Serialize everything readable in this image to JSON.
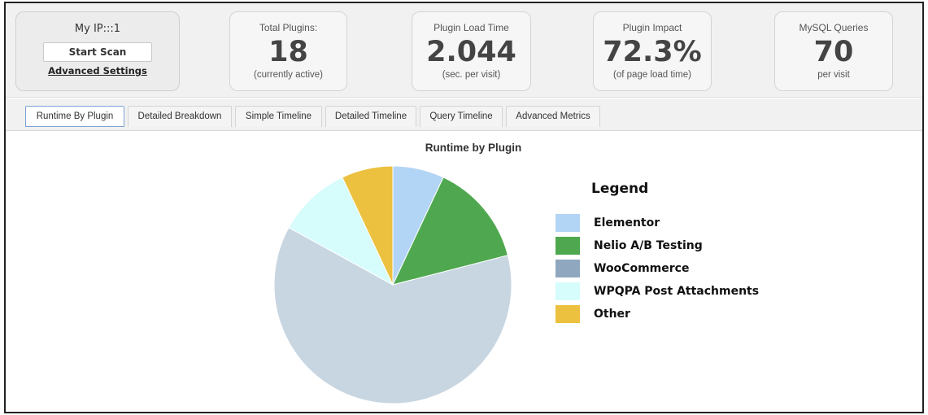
{
  "header": {
    "ip_label": "My IP:::1",
    "start_scan_label": "Start Scan",
    "advanced_settings_label": "Advanced Settings"
  },
  "stats": {
    "total_plugins": {
      "label": "Total Plugins:",
      "value": "18",
      "sub": "(currently active)"
    },
    "plugin_load_time": {
      "label": "Plugin Load Time",
      "value": "2.044",
      "sub": "(sec. per visit)"
    },
    "plugin_impact": {
      "label": "Plugin Impact",
      "value": "72.3%",
      "sub": "(of page load time)"
    },
    "mysql_queries": {
      "label": "MySQL Queries",
      "value": "70",
      "sub": "per visit"
    }
  },
  "tabs": [
    {
      "label": "Runtime By Plugin",
      "active": true
    },
    {
      "label": "Detailed Breakdown",
      "active": false
    },
    {
      "label": "Simple Timeline",
      "active": false
    },
    {
      "label": "Detailed Timeline",
      "active": false
    },
    {
      "label": "Query Timeline",
      "active": false
    },
    {
      "label": "Advanced Metrics",
      "active": false
    }
  ],
  "chart_data": {
    "type": "pie",
    "title": "Runtime by Plugin",
    "legend_title": "Legend",
    "legend_position": "right",
    "series": [
      {
        "name": "Elementor",
        "value": 7,
        "color": "#b3d5f5"
      },
      {
        "name": "Nelio A/B Testing",
        "value": 14,
        "color": "#4fa84f"
      },
      {
        "name": "WooCommerce",
        "value": 62,
        "color": "#c8d6e2",
        "legend_color": "#8fa8bf"
      },
      {
        "name": "WPQPA Post Attachments",
        "value": 10,
        "color": "#d6fcfc"
      },
      {
        "name": "Other",
        "value": 7,
        "color": "#ecc13f"
      }
    ]
  }
}
